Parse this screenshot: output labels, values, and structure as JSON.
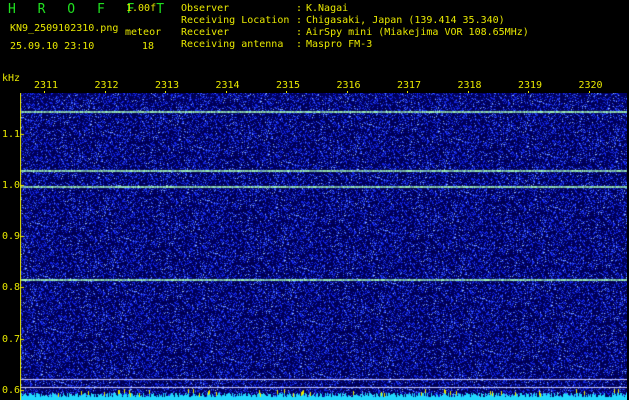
{
  "header": {
    "title": "H R O F F T",
    "version": "1.00f",
    "filename": "KN9_2509102310.png",
    "datetime": "25.09.10 23:10",
    "meteor_label": "meteor",
    "meteor_count": "18"
  },
  "info": [
    {
      "label": "Observer",
      "value": "K.Nagai"
    },
    {
      "label": "Receiving Location",
      "value": "Chigasaki, Japan (139.414 35.340)"
    },
    {
      "label": "Receiver",
      "value": "AirSpy mini (Miakejima VOR 108.65MHz)"
    },
    {
      "label": "Receiving antenna",
      "value": "Maspro FM-3"
    }
  ],
  "spectrogram": {
    "y_unit": "kHz",
    "x_ticks": [
      "2311",
      "2312",
      "2313",
      "2314",
      "2315",
      "2316",
      "2317",
      "2318",
      "2319",
      "2320"
    ],
    "y_ticks": [
      "1.1",
      "1.0",
      "0.9",
      "0.8",
      "0.7",
      "0.6"
    ],
    "y_range": [
      0.58,
      1.18
    ],
    "carrier_lines_khz": [
      1.145,
      1.03,
      0.998,
      0.817
    ],
    "reference_lines_khz": [
      0.622,
      0.605
    ],
    "colors": {
      "background": "#000066",
      "noise": "#2a3aff",
      "carrier": "#a8ffb8",
      "baseline": "#20d8ff",
      "text": "#e8e800"
    }
  }
}
